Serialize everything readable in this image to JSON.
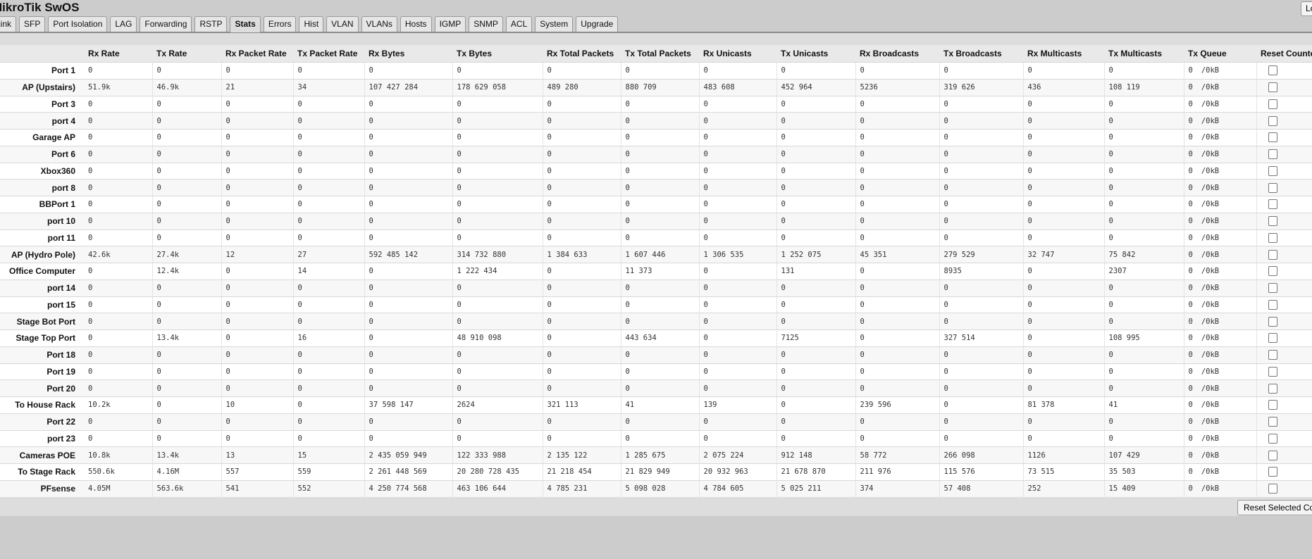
{
  "app": {
    "title": "MikroTik SwOS",
    "logout_label": "Logout"
  },
  "tabs": [
    "Link",
    "SFP",
    "Port Isolation",
    "LAG",
    "Forwarding",
    "RSTP",
    "Stats",
    "Errors",
    "Hist",
    "VLAN",
    "VLANs",
    "Hosts",
    "IGMP",
    "SNMP",
    "ACL",
    "System",
    "Upgrade"
  ],
  "active_tab": "Stats",
  "columns": [
    "",
    "Rx Rate",
    "Tx Rate",
    "Rx Packet Rate",
    "Tx Packet Rate",
    "Rx Bytes",
    "Tx Bytes",
    "Rx Total Packets",
    "Tx Total Packets",
    "Rx Unicasts",
    "Tx Unicasts",
    "Rx Broadcasts",
    "Tx Broadcasts",
    "Rx Multicasts",
    "Tx Multicasts",
    "Tx Queue",
    "Reset Counters"
  ],
  "rows": [
    {
      "name": "Port 1",
      "v": [
        "0",
        "0",
        "0",
        "0",
        "0",
        "0",
        "0",
        "0",
        "0",
        "0",
        "0",
        "0",
        "0",
        "0"
      ],
      "q": [
        "0",
        "/0kB"
      ]
    },
    {
      "name": "AP (Upstairs)",
      "v": [
        "51.9k",
        "46.9k",
        "21",
        "34",
        "107 427 284",
        "178 629 058",
        "489 280",
        "880 709",
        "483 608",
        "452 964",
        "5236",
        "319 626",
        "436",
        "108 119"
      ],
      "q": [
        "0",
        "/0kB"
      ]
    },
    {
      "name": "Port 3",
      "v": [
        "0",
        "0",
        "0",
        "0",
        "0",
        "0",
        "0",
        "0",
        "0",
        "0",
        "0",
        "0",
        "0",
        "0"
      ],
      "q": [
        "0",
        "/0kB"
      ]
    },
    {
      "name": "port 4",
      "v": [
        "0",
        "0",
        "0",
        "0",
        "0",
        "0",
        "0",
        "0",
        "0",
        "0",
        "0",
        "0",
        "0",
        "0"
      ],
      "q": [
        "0",
        "/0kB"
      ]
    },
    {
      "name": "Garage AP",
      "v": [
        "0",
        "0",
        "0",
        "0",
        "0",
        "0",
        "0",
        "0",
        "0",
        "0",
        "0",
        "0",
        "0",
        "0"
      ],
      "q": [
        "0",
        "/0kB"
      ]
    },
    {
      "name": "Port 6",
      "v": [
        "0",
        "0",
        "0",
        "0",
        "0",
        "0",
        "0",
        "0",
        "0",
        "0",
        "0",
        "0",
        "0",
        "0"
      ],
      "q": [
        "0",
        "/0kB"
      ]
    },
    {
      "name": "Xbox360",
      "v": [
        "0",
        "0",
        "0",
        "0",
        "0",
        "0",
        "0",
        "0",
        "0",
        "0",
        "0",
        "0",
        "0",
        "0"
      ],
      "q": [
        "0",
        "/0kB"
      ]
    },
    {
      "name": "port 8",
      "v": [
        "0",
        "0",
        "0",
        "0",
        "0",
        "0",
        "0",
        "0",
        "0",
        "0",
        "0",
        "0",
        "0",
        "0"
      ],
      "q": [
        "0",
        "/0kB"
      ]
    },
    {
      "name": "BBPort 1",
      "v": [
        "0",
        "0",
        "0",
        "0",
        "0",
        "0",
        "0",
        "0",
        "0",
        "0",
        "0",
        "0",
        "0",
        "0"
      ],
      "q": [
        "0",
        "/0kB"
      ]
    },
    {
      "name": "port 10",
      "v": [
        "0",
        "0",
        "0",
        "0",
        "0",
        "0",
        "0",
        "0",
        "0",
        "0",
        "0",
        "0",
        "0",
        "0"
      ],
      "q": [
        "0",
        "/0kB"
      ]
    },
    {
      "name": "port 11",
      "v": [
        "0",
        "0",
        "0",
        "0",
        "0",
        "0",
        "0",
        "0",
        "0",
        "0",
        "0",
        "0",
        "0",
        "0"
      ],
      "q": [
        "0",
        "/0kB"
      ]
    },
    {
      "name": "AP (Hydro Pole)",
      "v": [
        "42.6k",
        "27.4k",
        "12",
        "27",
        "592 485 142",
        "314 732 880",
        "1 384 633",
        "1 607 446",
        "1 306 535",
        "1 252 075",
        "45 351",
        "279 529",
        "32 747",
        "75 842"
      ],
      "q": [
        "0",
        "/0kB"
      ]
    },
    {
      "name": "Office Computer",
      "v": [
        "0",
        "12.4k",
        "0",
        "14",
        "0",
        "1 222 434",
        "0",
        "11 373",
        "0",
        "131",
        "0",
        "8935",
        "0",
        "2307"
      ],
      "q": [
        "0",
        "/0kB"
      ]
    },
    {
      "name": "port 14",
      "v": [
        "0",
        "0",
        "0",
        "0",
        "0",
        "0",
        "0",
        "0",
        "0",
        "0",
        "0",
        "0",
        "0",
        "0"
      ],
      "q": [
        "0",
        "/0kB"
      ]
    },
    {
      "name": "port 15",
      "v": [
        "0",
        "0",
        "0",
        "0",
        "0",
        "0",
        "0",
        "0",
        "0",
        "0",
        "0",
        "0",
        "0",
        "0"
      ],
      "q": [
        "0",
        "/0kB"
      ]
    },
    {
      "name": "Stage Bot Port",
      "v": [
        "0",
        "0",
        "0",
        "0",
        "0",
        "0",
        "0",
        "0",
        "0",
        "0",
        "0",
        "0",
        "0",
        "0"
      ],
      "q": [
        "0",
        "/0kB"
      ]
    },
    {
      "name": "Stage Top Port",
      "v": [
        "0",
        "13.4k",
        "0",
        "16",
        "0",
        "48 910 098",
        "0",
        "443 634",
        "0",
        "7125",
        "0",
        "327 514",
        "0",
        "108 995"
      ],
      "q": [
        "0",
        "/0kB"
      ]
    },
    {
      "name": "Port 18",
      "v": [
        "0",
        "0",
        "0",
        "0",
        "0",
        "0",
        "0",
        "0",
        "0",
        "0",
        "0",
        "0",
        "0",
        "0"
      ],
      "q": [
        "0",
        "/0kB"
      ]
    },
    {
      "name": "Port 19",
      "v": [
        "0",
        "0",
        "0",
        "0",
        "0",
        "0",
        "0",
        "0",
        "0",
        "0",
        "0",
        "0",
        "0",
        "0"
      ],
      "q": [
        "0",
        "/0kB"
      ]
    },
    {
      "name": "Port 20",
      "v": [
        "0",
        "0",
        "0",
        "0",
        "0",
        "0",
        "0",
        "0",
        "0",
        "0",
        "0",
        "0",
        "0",
        "0"
      ],
      "q": [
        "0",
        "/0kB"
      ]
    },
    {
      "name": "To House Rack",
      "v": [
        "10.2k",
        "0",
        "10",
        "0",
        "37 598 147",
        "2624",
        "321 113",
        "41",
        "139",
        "0",
        "239 596",
        "0",
        "81 378",
        "41"
      ],
      "q": [
        "0",
        "/0kB"
      ]
    },
    {
      "name": "Port 22",
      "v": [
        "0",
        "0",
        "0",
        "0",
        "0",
        "0",
        "0",
        "0",
        "0",
        "0",
        "0",
        "0",
        "0",
        "0"
      ],
      "q": [
        "0",
        "/0kB"
      ]
    },
    {
      "name": "port 23",
      "v": [
        "0",
        "0",
        "0",
        "0",
        "0",
        "0",
        "0",
        "0",
        "0",
        "0",
        "0",
        "0",
        "0",
        "0"
      ],
      "q": [
        "0",
        "/0kB"
      ]
    },
    {
      "name": "Cameras POE",
      "v": [
        "10.8k",
        "13.4k",
        "13",
        "15",
        "2 435 059 949",
        "122 333 988",
        "2 135 122",
        "1 285 675",
        "2 075 224",
        "912 148",
        "58 772",
        "266 098",
        "1126",
        "107 429"
      ],
      "q": [
        "0",
        "/0kB"
      ]
    },
    {
      "name": "To Stage Rack",
      "v": [
        "550.6k",
        "4.16M",
        "557",
        "559",
        "2 261 448 569",
        "20 280 728 435",
        "21 218 454",
        "21 829 949",
        "20 932 963",
        "21 678 870",
        "211 976",
        "115 576",
        "73 515",
        "35 503"
      ],
      "q": [
        "0",
        "/0kB"
      ]
    },
    {
      "name": "PFsense",
      "v": [
        "4.05M",
        "563.6k",
        "541",
        "552",
        "4 250 774 568",
        "463 106 644",
        "4 785 231",
        "5 098 028",
        "4 784 605",
        "5 025 211",
        "374",
        "57 408",
        "252",
        "15 409"
      ],
      "q": [
        "0",
        "/0kB"
      ]
    }
  ],
  "footer": {
    "reset_selected_label": "Reset Selected Counters"
  }
}
